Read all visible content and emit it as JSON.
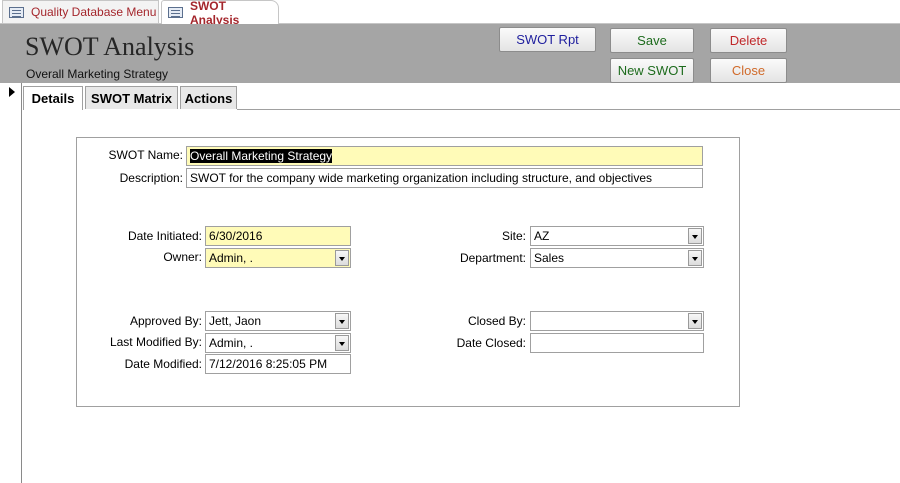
{
  "doc_tabs": [
    {
      "label": "Quality Database Menu"
    },
    {
      "label": "SWOT Analysis"
    }
  ],
  "header": {
    "title": "SWOT Analysis",
    "subtitle": "Overall Marketing Strategy",
    "buttons": {
      "swot_rpt": "SWOT Rpt",
      "save": "Save",
      "delete": "Delete",
      "new_swot": "New SWOT",
      "close": "Close"
    },
    "colors": {
      "band": "#a5a5a5",
      "swot_rpt_text": "#1f1f9e",
      "save_text": "#1d6b1d",
      "delete_text": "#c0282a",
      "new_swot_text": "#1d6b1d",
      "close_text": "#d06a2a"
    }
  },
  "form_tabs": [
    {
      "label": "Details"
    },
    {
      "label": "SWOT Matrix"
    },
    {
      "label": "Actions"
    }
  ],
  "fields": {
    "swot_name": {
      "label": "SWOT Name:",
      "value": "Overall Marketing Strategy"
    },
    "description": {
      "label": "Description:",
      "value": "SWOT for the company wide marketing organization including structure, and objectives"
    },
    "date_initiated": {
      "label": "Date Initiated:",
      "value": "6/30/2016"
    },
    "owner": {
      "label": "Owner:",
      "value": "Admin, ."
    },
    "site": {
      "label": "Site:",
      "value": "AZ"
    },
    "department": {
      "label": "Department:",
      "value": "Sales"
    },
    "approved_by": {
      "label": "Approved By:",
      "value": "Jett, Jaon"
    },
    "last_modified_by": {
      "label": "Last Modified By:",
      "value": "Admin, ."
    },
    "date_modified": {
      "label": "Date Modified:",
      "value": "7/12/2016 8:25:05 PM"
    },
    "closed_by": {
      "label": "Closed By:",
      "value": ""
    },
    "date_closed": {
      "label": "Date Closed:",
      "value": ""
    }
  },
  "icons": {
    "doc_tab": "form-icon",
    "record_selector": "current-record-arrow-icon",
    "dropdown": "chevron-down-icon"
  }
}
